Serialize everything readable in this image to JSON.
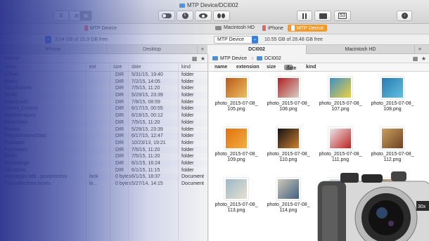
{
  "window": {
    "title": "MTP Device/DCI002"
  },
  "toolbar": {
    "tab_count": "53"
  },
  "devices": [
    {
      "label": "MTP Device"
    },
    {
      "label": "Macintosh HD"
    },
    {
      "label": "iPhone"
    },
    {
      "label": "MTP Device"
    }
  ],
  "left_path": {
    "free": "3.54 GB of 15.9 GB free"
  },
  "right_path": {
    "device": "MTP Device",
    "free": "10.55 GB of 28.48 GB free"
  },
  "tabs": [
    {
      "label": "iPhone"
    },
    {
      "label": "Desktop"
    },
    {
      "label": "DCI002"
    },
    {
      "label": "Macintosh HD"
    }
  ],
  "left_pane": {
    "breadcrumb": "iPhone",
    "headers": {
      "name": "name",
      "ext": "ext",
      "size": "size",
      "date": "date",
      "kind": "kind"
    },
    "rows": [
      {
        "name": "A/Test",
        "ext": "",
        "size": "DIR",
        "date": "5/31/15, 19:40",
        "kind": "folder"
      },
      {
        "name": "Books",
        "ext": "",
        "size": "DIR",
        "date": "7/2/15, 14:05",
        "kind": "folder"
      },
      {
        "name": "CloudAssets",
        "ext": "",
        "size": "DIR",
        "date": "7/5/15, 11:20",
        "kind": "folder"
      },
      {
        "name": "DCIM",
        "ext": "",
        "size": "DIR",
        "date": "5/29/15, 23:39",
        "kind": "folder"
      },
      {
        "name": "Downloads",
        "ext": "",
        "size": "DIR",
        "date": "7/8/15, 08:59",
        "kind": "folder"
      },
      {
        "name": "iTunes_Control",
        "ext": "",
        "size": "DIR",
        "date": "6/17/15, 00:55",
        "kind": "folder"
      },
      {
        "name": "MediaAnalysis",
        "ext": "",
        "size": "DIR",
        "date": "6/19/15, 00:12",
        "kind": "folder"
      },
      {
        "name": "PhotoData",
        "ext": "",
        "size": "DIR",
        "date": "7/5/15, 11:20",
        "kind": "folder"
      },
      {
        "name": "Photos",
        "ext": "",
        "size": "DIR",
        "date": "5/29/15, 23:39",
        "kind": "folder"
      },
      {
        "name": "PhotoStreamsData",
        "ext": "",
        "size": "DIR",
        "date": "6/17/15, 12:47",
        "kind": "folder"
      },
      {
        "name": "Podcasts",
        "ext": "",
        "size": "DIR",
        "date": "10/23/13, 19:21",
        "kind": "folder"
      },
      {
        "name": "Purchases",
        "ext": "",
        "size": "DIR",
        "date": "7/5/15, 11:20",
        "kind": "folder"
      },
      {
        "name": "Radio",
        "ext": "",
        "size": "DIR",
        "date": "7/5/15, 11:20",
        "kind": "folder"
      },
      {
        "name": "Recordings",
        "ext": "",
        "size": "DIR",
        "date": "6/1/15, 16:24",
        "kind": "folder"
      },
      {
        "name": "Vibrations",
        "ext": "",
        "size": "DIR",
        "date": "6/1/15, 11:15",
        "kind": "folder"
      },
      {
        "name": "com.apple.itdb...postprocess",
        "ext": "lock",
        "size": "0 bytes",
        "date": "6/1/15, 18:37",
        "kind": "Document"
      },
      {
        "name": "iTunesRestore.itunes",
        "ext": "lo...",
        "size": "0 bytes",
        "date": "5/27/14, 14:15",
        "kind": "Document"
      }
    ]
  },
  "right_pane": {
    "breadcrumb": [
      "MTP Device",
      "DCI002"
    ],
    "headers": {
      "name": "name",
      "extension": "extension",
      "size": "size",
      "date": "date",
      "kind": "kind"
    },
    "files": [
      {
        "line1": "photo_2015-07-08_",
        "line2": "105.png",
        "colors": [
          "#b85a1a",
          "#f0c060"
        ]
      },
      {
        "line1": "photo_2015-07-08_",
        "line2": "106.png",
        "colors": [
          "#b02020",
          "#d8d0c8"
        ]
      },
      {
        "line1": "photo_2015-07-08_",
        "line2": "107.png",
        "colors": [
          "#3a90c8",
          "#f0d040"
        ]
      },
      {
        "line1": "photo_2015-07-08_",
        "line2": "108.png",
        "colors": [
          "#2a7ab0",
          "#60c0e0"
        ]
      },
      {
        "line1": "photo_2015-07-08_",
        "line2": "109.png",
        "colors": [
          "#e07010",
          "#f4b040"
        ]
      },
      {
        "line1": "photo_2015-07-08_",
        "line2": "110.png",
        "colors": [
          "#111111",
          "#d08030"
        ]
      },
      {
        "line1": "photo_2015-07-08_",
        "line2": "111.png",
        "colors": [
          "#e8e8e8",
          "#c02020"
        ]
      },
      {
        "line1": "photo_2015-07-08_",
        "line2": "112.png",
        "colors": [
          "#c8a060",
          "#704020"
        ]
      },
      {
        "line1": "photo_2015-07-08_",
        "line2": "113.png",
        "colors": [
          "#9ab8c8",
          "#e8e0d0"
        ]
      },
      {
        "line1": "photo_2015-07-08_",
        "line2": "114.png",
        "colors": [
          "#d0c8b8",
          "#406080"
        ]
      },
      {
        "line1": "",
        "line2": "",
        "colors": [
          "#c8d8e8",
          "#f0f0f0"
        ]
      },
      {
        "line1": "",
        "line2": "",
        "colors": [
          "#b89060",
          "#e0e8f0"
        ]
      }
    ]
  },
  "camera": {
    "badge": "30x"
  }
}
